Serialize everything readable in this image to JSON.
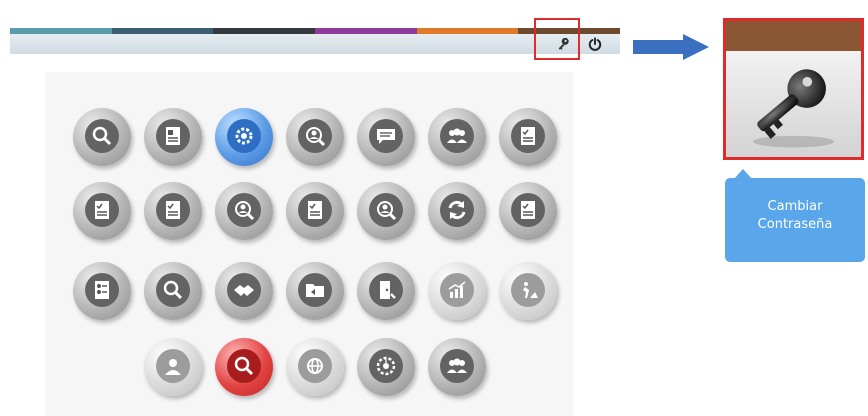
{
  "top_bar": {
    "stripe_colors": [
      "#5b9aa8",
      "#3a5f72",
      "#333a3f",
      "#8e3c9c",
      "#e07a2a",
      "#6b4a2e"
    ],
    "icons": [
      "key-icon",
      "power-icon"
    ]
  },
  "arrow": {
    "color": "#3b6fbf",
    "icon": "arrow-right-icon"
  },
  "zoom": {
    "icon": "key-icon",
    "header_color": "#8b5634"
  },
  "tooltip": {
    "line1": "Cambiar",
    "line2": "Contraseña",
    "color": "#5aa6ea"
  },
  "grid": {
    "rows": [
      [
        {
          "icon": "search-user-icon",
          "style": "grey"
        },
        {
          "icon": "document-icon",
          "style": "grey"
        },
        {
          "icon": "settings-gear-icon",
          "style": "blue"
        },
        {
          "icon": "user-group-search-icon",
          "style": "grey"
        },
        {
          "icon": "chat-message-icon",
          "style": "grey"
        },
        {
          "icon": "users-icon",
          "style": "grey"
        },
        {
          "icon": "checklist-icon",
          "style": "grey"
        }
      ],
      [
        {
          "icon": "checklist-icon",
          "style": "grey"
        },
        {
          "icon": "checklist-icon",
          "style": "grey"
        },
        {
          "icon": "user-group-search-icon",
          "style": "grey"
        },
        {
          "icon": "checklist-icon",
          "style": "grey"
        },
        {
          "icon": "user-group-search-icon",
          "style": "grey"
        },
        {
          "icon": "refresh-icon",
          "style": "grey"
        },
        {
          "icon": "checklist-icon",
          "style": "grey"
        }
      ],
      [
        {
          "icon": "contact-list-icon",
          "style": "grey"
        },
        {
          "icon": "search-user-icon",
          "style": "grey"
        },
        {
          "icon": "handshake-icon",
          "style": "grey"
        },
        {
          "icon": "folder-transfer-icon",
          "style": "grey"
        },
        {
          "icon": "door-exit-icon",
          "style": "grey"
        },
        {
          "icon": "chart-growth-icon",
          "style": "light"
        },
        {
          "icon": "road-work-icon",
          "style": "light"
        }
      ],
      [
        {
          "icon": "user-profile-icon",
          "style": "light"
        },
        {
          "icon": "search-user-icon",
          "style": "red"
        },
        {
          "icon": "globe-network-icon",
          "style": "light"
        },
        {
          "icon": "circuit-gear-icon",
          "style": "grey"
        },
        {
          "icon": "users-icon",
          "style": "grey"
        }
      ]
    ]
  }
}
